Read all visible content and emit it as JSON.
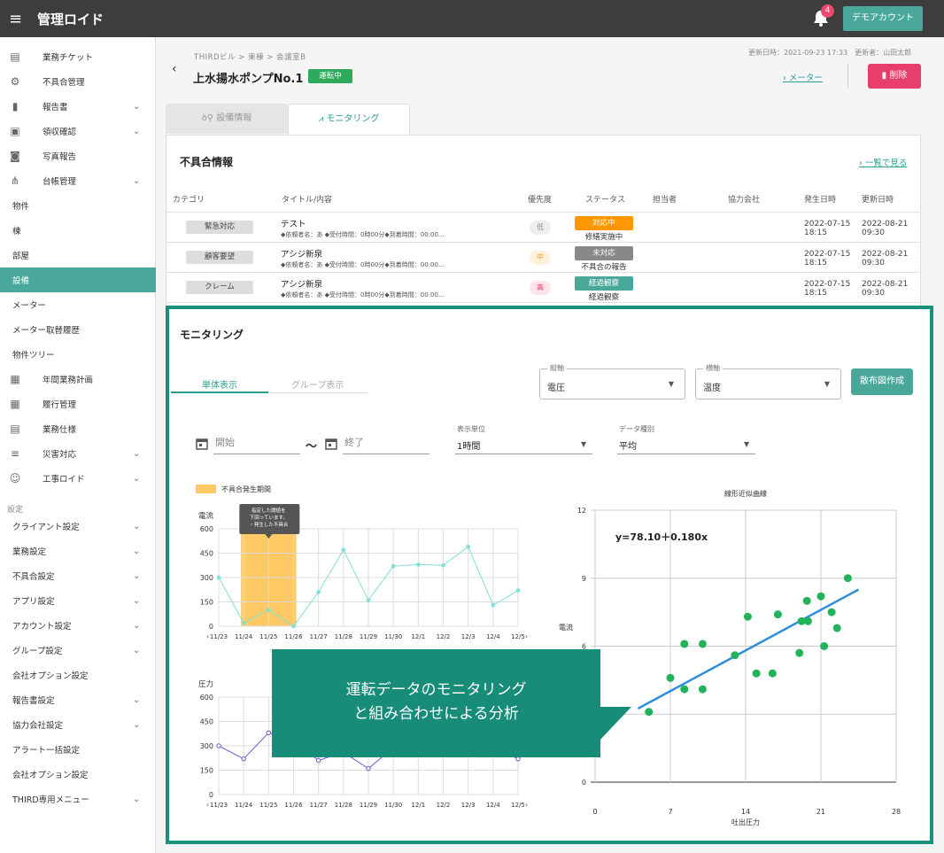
{
  "app": {
    "brand": "管理ロイド",
    "notification_count": "4",
    "account_button": "デモアカウント"
  },
  "sidebar": {
    "items": [
      {
        "label": "業務チケット",
        "icon": "ticket-icon",
        "chevron": false
      },
      {
        "label": "不具合管理",
        "icon": "gear-icon",
        "chevron": false
      },
      {
        "label": "報告書",
        "icon": "document-icon",
        "chevron": true
      },
      {
        "label": "領収確認",
        "icon": "receipt-icon",
        "chevron": true
      },
      {
        "label": "写真報告",
        "icon": "camera-icon",
        "chevron": false
      },
      {
        "label": "台帳管理",
        "icon": "hierarchy-icon",
        "chevron": true
      }
    ],
    "sub_items": [
      "物件",
      "棟",
      "部屋",
      "設備",
      "メーター",
      "メーター取替履歴",
      "物件ツリー"
    ],
    "active_sub": "設備",
    "items2": [
      {
        "label": "年間業務計画",
        "icon": "calendar-icon",
        "chevron": false
      },
      {
        "label": "履行管理",
        "icon": "calendar-grid-icon",
        "chevron": false
      },
      {
        "label": "業務仕様",
        "icon": "clipboard-icon",
        "chevron": false
      },
      {
        "label": "災害対応",
        "icon": "filter-icon",
        "chevron": true
      },
      {
        "label": "工事ロイド",
        "icon": "robot-icon",
        "chevron": true
      }
    ],
    "settings_header": "設定",
    "settings": [
      {
        "label": "クライアント設定",
        "chevron": true
      },
      {
        "label": "業務設定",
        "chevron": true
      },
      {
        "label": "不具合設定",
        "chevron": true
      },
      {
        "label": "アプリ設定",
        "chevron": true
      },
      {
        "label": "アカウント設定",
        "chevron": true
      },
      {
        "label": "グループ設定",
        "chevron": true
      },
      {
        "label": "会社オプション設定",
        "chevron": false
      },
      {
        "label": "報告書設定",
        "chevron": true
      },
      {
        "label": "協力会社設定",
        "chevron": true
      },
      {
        "label": "アラート一括設定",
        "chevron": false
      },
      {
        "label": "会社オプション設定",
        "chevron": false
      },
      {
        "label": "THIRD専用メニュー",
        "chevron": true
      }
    ]
  },
  "page": {
    "breadcrumb": "THIRDビル > 東棟 > 会議室B",
    "title": "上水揚水ポンプNo.1",
    "status": "運転中",
    "update_info": "更新日時：2021-09-23 17:33　更新者：山田太郎",
    "meter_link": "メーター",
    "delete_button": "削除",
    "tabs": [
      "設備情報",
      "モニタリング"
    ]
  },
  "defects": {
    "title": "不具合情報",
    "view_all": "一覧で見る",
    "headers": [
      "カテゴリ",
      "タイトル/内容",
      "優先度",
      "ステータス",
      "担当者",
      "協力会社",
      "発生日時",
      "更新日時"
    ],
    "rows": [
      {
        "category": "緊急対応",
        "title": "テスト",
        "detail": "◆依頼者名：あ ◆受付時間：0時00分◆到着時間：00:00...",
        "priority": "低",
        "status_badge": "対応中",
        "status_text": "修繕実施中",
        "occurred_date": "2022-07-15",
        "occurred_time": "18:15",
        "updated_date": "2022-08-21",
        "updated_time": "09:30"
      },
      {
        "category": "顧客要望",
        "title": "アシジ新泉",
        "detail": "◆依頼者名：あ ◆受付時間：0時00分◆到着時間：00:00...",
        "priority": "中",
        "status_badge": "未対応",
        "status_text": "不具合の報告",
        "occurred_date": "2022-07-15",
        "occurred_time": "18:15",
        "updated_date": "2022-08-21",
        "updated_time": "09:30"
      },
      {
        "category": "クレーム",
        "title": "アシジ新泉",
        "detail": "◆依頼者名：あ ◆受付時間：0時00分◆到着時間：00:00...",
        "priority": "高",
        "status_badge": "経過観察",
        "status_text": "経過観察",
        "occurred_date": "2022-07-15",
        "occurred_time": "18:15",
        "updated_date": "2022-08-21",
        "updated_time": "09:30"
      }
    ]
  },
  "monitoring": {
    "title": "モニタリング",
    "view_tabs": [
      "単体表示",
      "グループ表示"
    ],
    "y_axis_select": {
      "label": "縦軸",
      "value": "電圧"
    },
    "x_axis_select": {
      "label": "横軸",
      "value": "温度"
    },
    "scatter_button": "散布図作成",
    "start_placeholder": "開始",
    "end_placeholder": "終了",
    "tilde": "〜",
    "unit": {
      "label": "表示単位",
      "value": "1時間"
    },
    "data_type": {
      "label": "データ種別",
      "value": "平均"
    },
    "legend": "不具合発生期間",
    "tooltip_lines": [
      "指定した閾値を",
      "下回っています。",
      "・発生した不具合"
    ],
    "callout_lines": [
      "運転データのモニタリング",
      "と組み合わせによる分析"
    ]
  },
  "colors": {
    "accent": "#4aa89b",
    "active": "#2a9d8f",
    "delete": "#e83e6c",
    "orange": "#ff9800",
    "line1": "#7fe0d4",
    "line2": "#5b5bd6",
    "scatter": "#22b35a",
    "fit": "#2e8fdc"
  },
  "chart_data": [
    {
      "type": "line",
      "ylabel": "電流",
      "categories": [
        "11/23",
        "11/24",
        "11/25",
        "11/26",
        "11/27",
        "11/28",
        "11/29",
        "11/30",
        "12/1",
        "12/2",
        "12/3",
        "12/4",
        "12/5"
      ],
      "series": [
        {
          "values": [
            300,
            20,
            100,
            0,
            210,
            470,
            160,
            370,
            380,
            375,
            490,
            130,
            220
          ]
        }
      ],
      "ylim": [
        0,
        600
      ],
      "yticks": [
        0,
        150,
        300,
        450,
        600
      ],
      "highlight": {
        "from": "11/24",
        "to": "11/26"
      },
      "grid": true
    },
    {
      "type": "line",
      "ylabel": "圧力",
      "categories": [
        "11/23",
        "11/24",
        "11/25",
        "11/26",
        "11/27",
        "11/28",
        "11/29",
        "11/30",
        "12/1",
        "12/2",
        "12/3",
        "12/4",
        "12/5"
      ],
      "series": [
        {
          "values": [
            300,
            220,
            380,
            330,
            210,
            260,
            160,
            290,
            290,
            290,
            290,
            290,
            220
          ]
        }
      ],
      "ylim": [
        0,
        600
      ],
      "yticks": [
        0,
        150,
        300,
        450,
        600
      ],
      "grid": true
    },
    {
      "type": "scatter",
      "title": "線形近似曲線",
      "xlabel": "吐出圧力",
      "ylabel": "電流",
      "equation": "y=78.10＋0.180x",
      "xlim": [
        0,
        28
      ],
      "ylim": [
        0,
        12
      ],
      "xticks": [
        0,
        7,
        14,
        21,
        28
      ],
      "yticks": [
        0,
        3,
        6,
        9,
        12
      ],
      "points": [
        [
          5,
          3.1
        ],
        [
          7,
          4.6
        ],
        [
          8.3,
          6.1
        ],
        [
          8.3,
          4.1
        ],
        [
          10,
          6.1
        ],
        [
          10,
          4.1
        ],
        [
          13,
          5.6
        ],
        [
          14.2,
          7.3
        ],
        [
          15,
          4.8
        ],
        [
          16.5,
          4.8
        ],
        [
          17,
          7.4
        ],
        [
          19,
          5.7
        ],
        [
          19.2,
          7.1
        ],
        [
          19.8,
          7.1
        ],
        [
          19.7,
          8.0
        ],
        [
          21,
          8.2
        ],
        [
          21.3,
          6.0
        ],
        [
          22,
          7.5
        ],
        [
          22.5,
          6.8
        ],
        [
          23.5,
          9.0
        ]
      ],
      "fit_line": [
        [
          4,
          3.25
        ],
        [
          24.5,
          8.5
        ]
      ],
      "grid": true
    }
  ]
}
